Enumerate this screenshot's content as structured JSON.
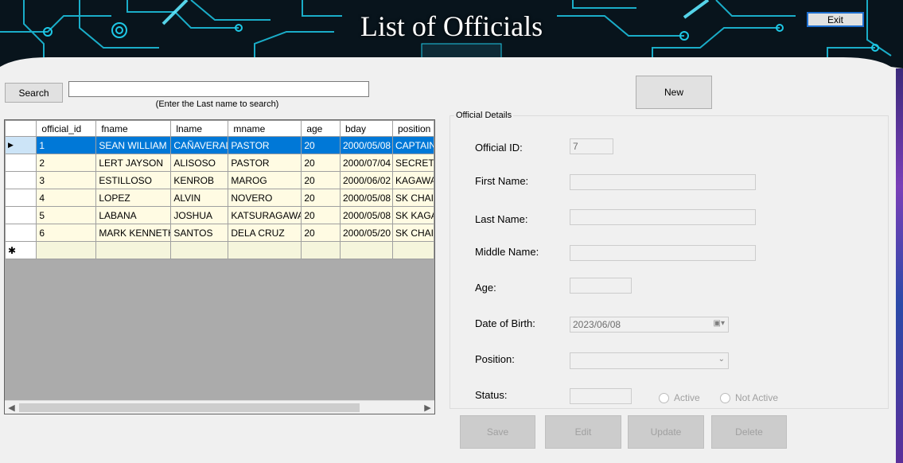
{
  "header": {
    "title": "List of Officials",
    "exit_label": "Exit"
  },
  "search": {
    "button_label": "Search",
    "value": "",
    "hint": "(Enter the Last name to search)"
  },
  "new_button_label": "New",
  "grid": {
    "columns": [
      "official_id",
      "fname",
      "lname",
      "mname",
      "age",
      "bday",
      "position"
    ],
    "rows": [
      [
        "1",
        "SEAN WILLIAM",
        "CAÑAVERAL",
        "PASTOR",
        "20",
        "2000/05/08",
        "CAPTAIN"
      ],
      [
        "2",
        "LERT JAYSON",
        "ALISOSO",
        "PASTOR",
        "20",
        "2000/07/04",
        "SECRETA"
      ],
      [
        "3",
        "ESTILLOSO",
        "KENROB",
        "MAROG",
        "20",
        "2000/06/02",
        "KAGAWA"
      ],
      [
        "4",
        "LOPEZ",
        "ALVIN",
        "NOVERO",
        "20",
        "2000/05/08",
        "SK CHAIF"
      ],
      [
        "5",
        "LABANA",
        "JOSHUA",
        "KATSURAGAWA",
        "20",
        "2000/05/08",
        "SK KAGA"
      ],
      [
        "6",
        "MARK KENNETH",
        "SANTOS",
        "DELA CRUZ",
        "20",
        "2000/05/20",
        "SK CHAIF"
      ]
    ],
    "selected_row": 0,
    "new_row_marker": "✱",
    "selected_marker": "▶"
  },
  "details": {
    "group_title": "Official Details",
    "official_id_label": "Official ID:",
    "official_id_value": "7",
    "first_name_label": "First Name:",
    "first_name_value": "",
    "last_name_label": "Last Name:",
    "last_name_value": "",
    "middle_name_label": "Middle Name:",
    "middle_name_value": "",
    "age_label": "Age:",
    "age_value": "",
    "dob_label": "Date of Birth:",
    "dob_value": "2023/06/08",
    "position_label": "Position:",
    "position_value": "",
    "status_label": "Status:",
    "status_value": "",
    "active_label": "Active",
    "not_active_label": "Not Active"
  },
  "actions": {
    "save": "Save",
    "edit": "Edit",
    "update": "Update",
    "delete": "Delete"
  },
  "colors": {
    "selection": "#0078d7",
    "row_bg": "#fffbe3",
    "banner_bg": "#08141c",
    "circuit": "#1ec8e6"
  }
}
